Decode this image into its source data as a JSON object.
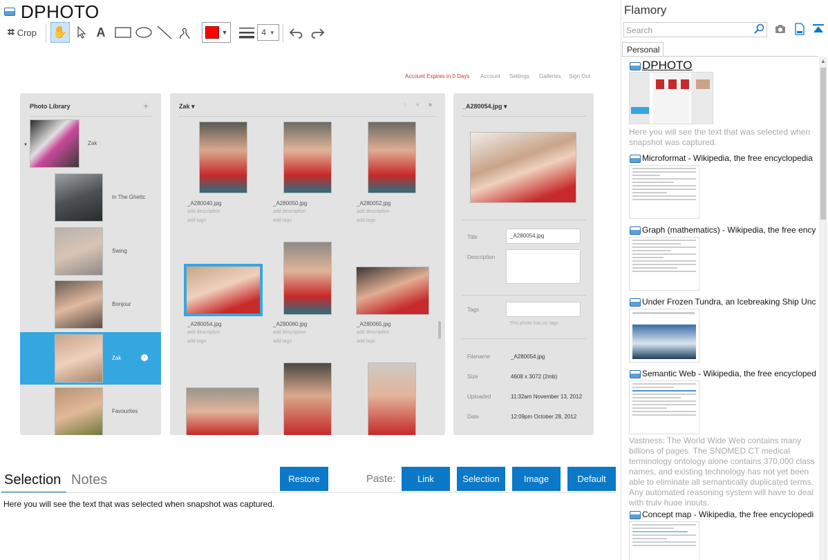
{
  "app": {
    "title": "DPHOTO"
  },
  "toolbar": {
    "crop_label": "Crop",
    "text_tool": "A",
    "line_width": "4"
  },
  "site": {
    "nav": [
      "Account Expires in 0 Days",
      "Account",
      "Settings",
      "Galleries",
      "Sign Out"
    ],
    "library": {
      "header": "Photo Library",
      "add": "+",
      "albums": [
        {
          "label": "Zak",
          "selected": false
        },
        {
          "label": "In The Ghettc",
          "selected": false
        },
        {
          "label": "Swing",
          "selected": false
        },
        {
          "label": "Bonjour",
          "selected": false
        },
        {
          "label": "Zak",
          "selected": true
        },
        {
          "label": "Favourites",
          "selected": false
        }
      ]
    },
    "gallery": {
      "header": "Zak ▾",
      "photos": [
        {
          "name": "_A280040.jpg",
          "desc": "add description",
          "tags": "add tags"
        },
        {
          "name": "_A280050.jpg",
          "desc": "add description",
          "tags": "add tags"
        },
        {
          "name": "_A280052.jpg",
          "desc": "add description",
          "tags": "add tags"
        },
        {
          "name": "_A280054.jpg",
          "desc": "add description",
          "tags": "add tags"
        },
        {
          "name": "_A280060.jpg",
          "desc": "add description",
          "tags": "add tags"
        },
        {
          "name": "_A280065.jpg",
          "desc": "add description",
          "tags": "add tags"
        }
      ]
    },
    "detail": {
      "header": "_A280054.jpg ▾",
      "title_label": "Title",
      "title_value": "_A280054.jpg",
      "description_label": "Description",
      "tags_label": "Tags",
      "tags_hint": "This photo has no tags",
      "filename_label": "Filename",
      "filename_value": "_A280054.jpg",
      "size_label": "Size",
      "size_value": "4608 x 3072 (2mb)",
      "uploaded_label": "Uploaded",
      "uploaded_value": "11:32am November 13, 2012",
      "date_label": "Date",
      "date_value": "12:09pm October 28, 2012"
    }
  },
  "bottom": {
    "tab_selection": "Selection",
    "tab_notes": "Notes",
    "restore": "Restore",
    "paste_label": "Paste:",
    "link": "Link",
    "selection": "Selection",
    "image": "Image",
    "default": "Default",
    "selected_text": "Here you will see the text that was selected when snapshot was captured."
  },
  "flamory": {
    "title": "Flamory",
    "search_placeholder": "Search",
    "tab": "Personal",
    "items": [
      {
        "title": "DPHOTO",
        "desc": "Here you will see the text that was selected when snapshot was captured."
      },
      {
        "title": "Microformat - Wikipedia, the free encyclopedia",
        "desc": ""
      },
      {
        "title": "Graph (mathematics) - Wikipedia, the free ency",
        "desc": ""
      },
      {
        "title": "Under Frozen Tundra, an Icebreaking Ship Unco",
        "desc": ""
      },
      {
        "title": "Semantic Web - Wikipedia, the free encycloped",
        "desc": "Vastness: The World Wide Web contains many billions of pages. The SNOMED CT medical terminology ontology alone contains 370,000 class names, and existing technology has not yet been able to eliminate all semantically duplicated terms. Any automated reasoning system will have to deal with truly huge inputs."
      },
      {
        "title": "Concept map - Wikipedia, the free encyclopedi",
        "desc": ""
      }
    ]
  },
  "colors": {
    "accent": "#0b78c8",
    "selected_album": "#35a7e0",
    "swatch": "#ff0000"
  }
}
